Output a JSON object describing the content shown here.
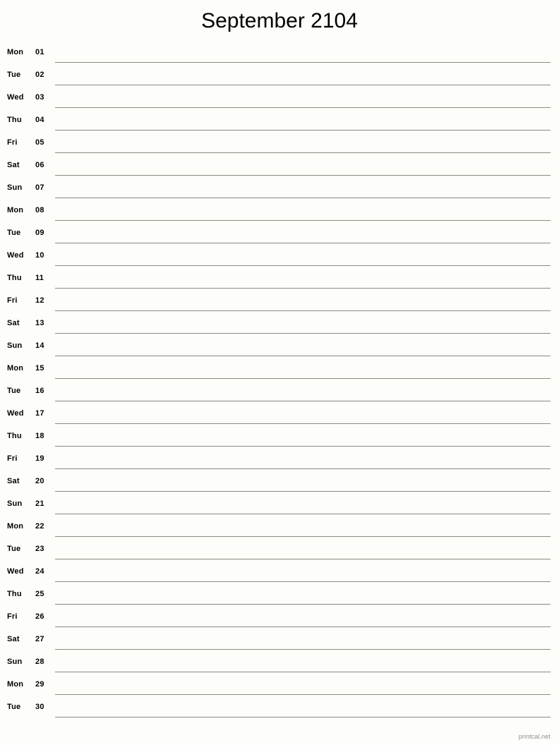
{
  "page": {
    "title": "September 2104",
    "footer": "printcal.net",
    "background_color": "#fdfdf9",
    "text_color": "#000000",
    "rule_color": "#8a8a84",
    "footer_color": "#8d8d8d"
  },
  "calendar": {
    "month": "September",
    "year": "2104",
    "days": [
      {
        "dow": "Mon",
        "num": "01"
      },
      {
        "dow": "Tue",
        "num": "02"
      },
      {
        "dow": "Wed",
        "num": "03"
      },
      {
        "dow": "Thu",
        "num": "04"
      },
      {
        "dow": "Fri",
        "num": "05"
      },
      {
        "dow": "Sat",
        "num": "06"
      },
      {
        "dow": "Sun",
        "num": "07"
      },
      {
        "dow": "Mon",
        "num": "08"
      },
      {
        "dow": "Tue",
        "num": "09"
      },
      {
        "dow": "Wed",
        "num": "10"
      },
      {
        "dow": "Thu",
        "num": "11"
      },
      {
        "dow": "Fri",
        "num": "12"
      },
      {
        "dow": "Sat",
        "num": "13"
      },
      {
        "dow": "Sun",
        "num": "14"
      },
      {
        "dow": "Mon",
        "num": "15"
      },
      {
        "dow": "Tue",
        "num": "16"
      },
      {
        "dow": "Wed",
        "num": "17"
      },
      {
        "dow": "Thu",
        "num": "18"
      },
      {
        "dow": "Fri",
        "num": "19"
      },
      {
        "dow": "Sat",
        "num": "20"
      },
      {
        "dow": "Sun",
        "num": "21"
      },
      {
        "dow": "Mon",
        "num": "22"
      },
      {
        "dow": "Tue",
        "num": "23"
      },
      {
        "dow": "Wed",
        "num": "24"
      },
      {
        "dow": "Thu",
        "num": "25"
      },
      {
        "dow": "Fri",
        "num": "26"
      },
      {
        "dow": "Sat",
        "num": "27"
      },
      {
        "dow": "Sun",
        "num": "28"
      },
      {
        "dow": "Mon",
        "num": "29"
      },
      {
        "dow": "Tue",
        "num": "30"
      }
    ]
  }
}
